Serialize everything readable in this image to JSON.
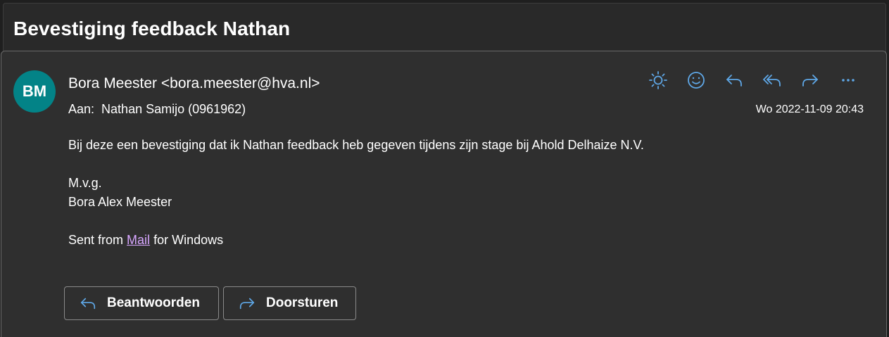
{
  "email": {
    "subject": "Bevestiging feedback Nathan",
    "sender": {
      "initials": "BM",
      "display": "Bora Meester <bora.meester@hva.nl>",
      "avatar_color": "#038387"
    },
    "to_label": "Aan:",
    "to_value": "Nathan Samijo (0961962)",
    "date": "Wo 2022-11-09 20:43",
    "body": {
      "line1": "Bij deze een bevestiging dat ik Nathan feedback heb gegeven tijdens zijn stage bij Ahold Delhaize N.V.",
      "greeting": "M.v.g.",
      "signature": "Bora Alex Meester",
      "sent_prefix": "Sent from",
      "sent_link": "Mail",
      "sent_suffix": "for Windows"
    }
  },
  "toolbar": {
    "icons": [
      "sun-icon",
      "smiley-icon",
      "reply-icon",
      "reply-all-icon",
      "forward-icon",
      "more-icon"
    ],
    "accent": "#5fa8e8"
  },
  "buttons": {
    "reply_label": "Beantwoorden",
    "forward_label": "Doorsturen"
  },
  "colors": {
    "background": "#292929",
    "card": "#2f2f2f",
    "link": "#d7a6ff"
  }
}
